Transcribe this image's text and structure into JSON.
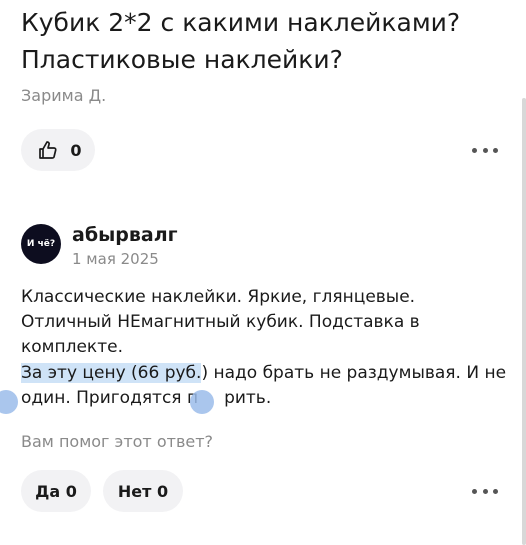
{
  "question": {
    "title": "Кубик 2*2 с какими наклейками? Пластиковые наклейки?",
    "author": "Зарима Д.",
    "like_count": "0"
  },
  "answer": {
    "avatar_text": "И чё?",
    "author": "абырвалг",
    "date": "1 мая 2025",
    "line1": "Классические наклейки. Яркие, глянцевые.",
    "line2": "Отличный НЕмагнитный кубик. Подставка в комплекте.",
    "selected_text": "За эту цену (66 руб.",
    "after_selection": ") надо брать не раздумывая. И не",
    "line4a": "один. Пригодятся п",
    "line4b": "рить."
  },
  "feedback": {
    "prompt": "Вам помог этот ответ?",
    "yes_label": "Да 0",
    "no_label": "Нет 0"
  }
}
